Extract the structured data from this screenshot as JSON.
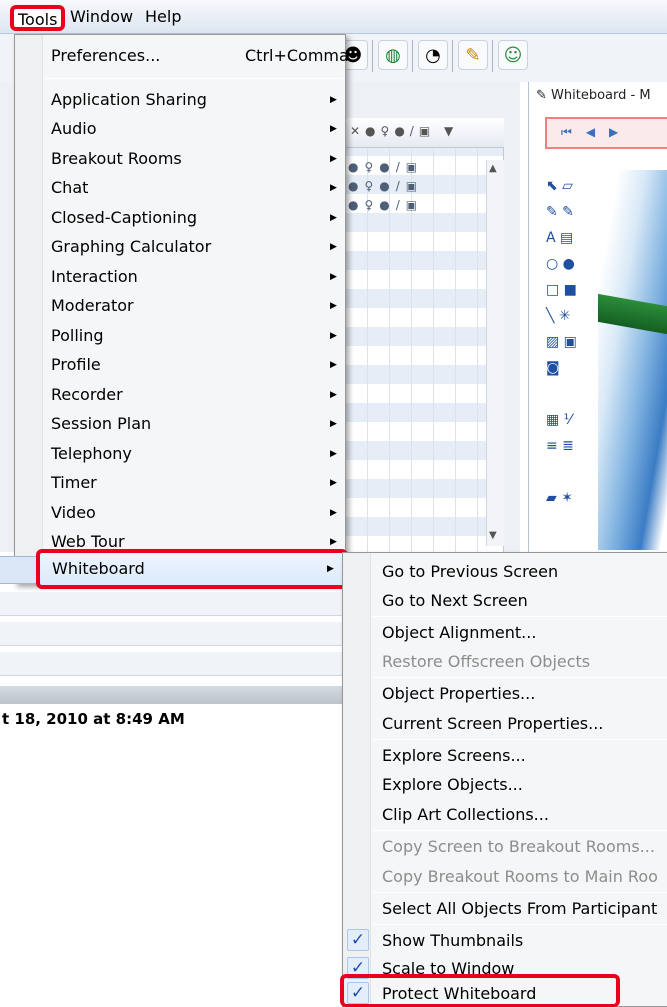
{
  "menubar": {
    "tools": "Tools",
    "window": "Window",
    "help": "Help"
  },
  "tools_menu": {
    "preferences": {
      "label": "Preferences...",
      "shortcut": "Ctrl+Comma"
    },
    "items": [
      "Application Sharing",
      "Audio",
      "Breakout Rooms",
      "Chat",
      "Closed-Captioning",
      "Graphing Calculator",
      "Interaction",
      "Moderator",
      "Polling",
      "Profile",
      "Recorder",
      "Session Plan",
      "Telephony",
      "Timer",
      "Video",
      "Web Tour"
    ],
    "whiteboard": "Whiteboard"
  },
  "whiteboard_menu": {
    "group1": [
      "Go to Previous Screen",
      "Go to Next Screen"
    ],
    "group2": [
      "Object Alignment...",
      "Restore Offscreen Objects"
    ],
    "group3": [
      "Object Properties...",
      "Current Screen Properties..."
    ],
    "group4": [
      "Explore Screens...",
      "Explore Objects...",
      "Clip Art Collections..."
    ],
    "group5": [
      "Copy Screen to Breakout Rooms...",
      "Copy Breakout Rooms to Main Roo"
    ],
    "group6": [
      "Select All Objects From Participant"
    ],
    "checked": [
      "Show Thumbnails",
      "Scale to Window",
      "Protect Whiteboard"
    ],
    "check_mark": "✓",
    "disabled": [
      "Restore Offscreen Objects",
      "Copy Screen to Breakout Rooms...",
      "Copy Breakout Rooms to Main Roo"
    ]
  },
  "background": {
    "whiteboard_title": "Whiteboard - M",
    "session_date": "t 18, 2010 at 8:49 AM"
  },
  "colors": {
    "highlight_red": "#e8001c",
    "menu_bg": "#f5f6f7",
    "check_blue": "#1c4fb5"
  }
}
